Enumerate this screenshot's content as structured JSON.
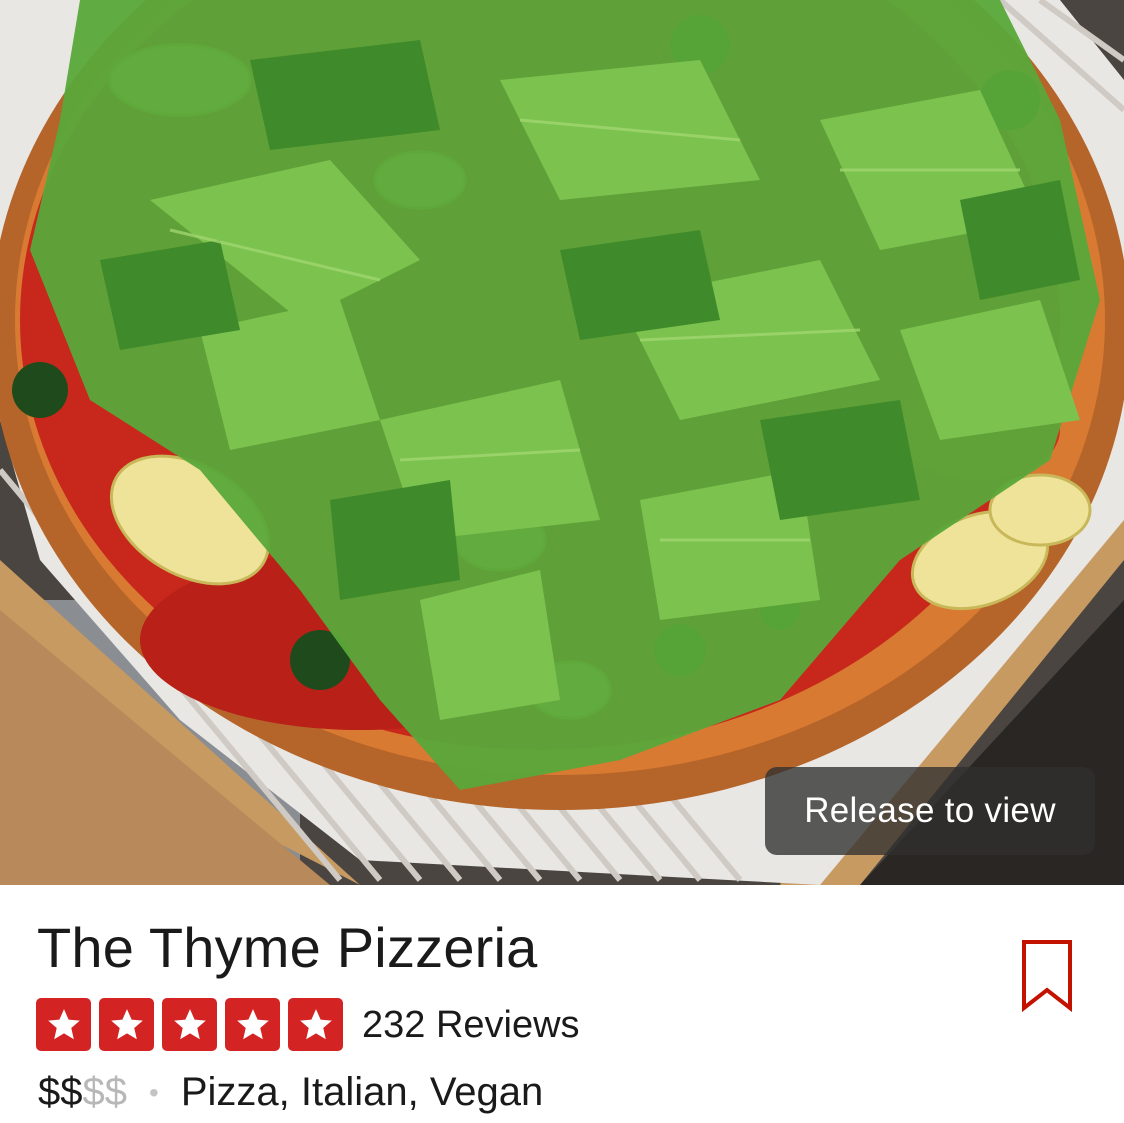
{
  "photo": {
    "alt_icon": "pizza-photo",
    "overlay_label": "Release to view"
  },
  "business": {
    "name": "The Thyme Pizzeria",
    "rating": 5,
    "rating_max": 5,
    "reviews_text": "232 Reviews",
    "price_active": "$$",
    "price_inactive": "$$",
    "separator": "•",
    "categories": "Pizza, Italian, Vegan"
  },
  "colors": {
    "star_red": "#d32323",
    "bookmark_red": "#c41200"
  },
  "icons": {
    "bookmark": "bookmark-icon",
    "star": "star-icon"
  }
}
